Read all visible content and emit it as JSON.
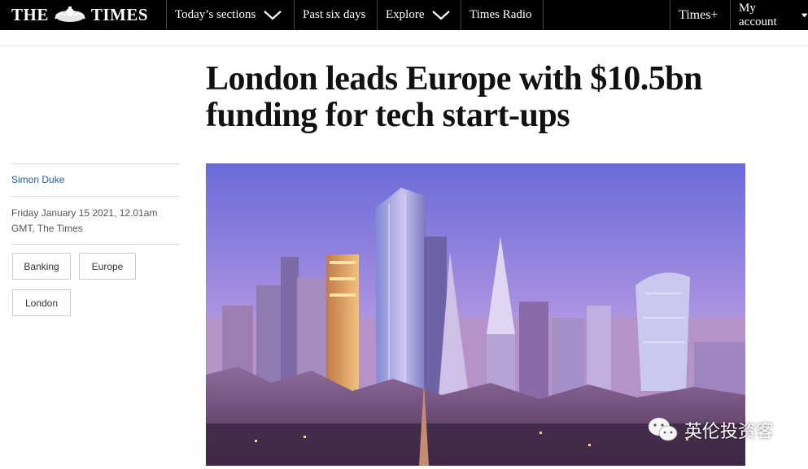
{
  "nav": {
    "logo_left": "THE",
    "logo_right": "TIMES",
    "items": [
      {
        "label": "Today’s sections",
        "has_dropdown": true
      },
      {
        "label": "Past six days",
        "has_dropdown": false
      },
      {
        "label": "Explore",
        "has_dropdown": true
      },
      {
        "label": "Times Radio",
        "has_dropdown": false
      }
    ],
    "times_plus": "Times+",
    "my_account": "My account"
  },
  "article": {
    "headline": "London leads Europe with $10.5bn funding for tech start-ups",
    "author": "Simon Duke",
    "date": "Friday January 15 2021, 12.01am GMT, The Times",
    "tags": [
      "Banking",
      "Europe",
      "London"
    ]
  },
  "watermark": {
    "text": "英伦投资客",
    "icon": "wechat-icon"
  },
  "colors": {
    "nav_bg": "#000000",
    "author_link": "#1f5d9b",
    "sky_top": "#6a6bd8",
    "sky_bottom": "#d6b6e6"
  }
}
